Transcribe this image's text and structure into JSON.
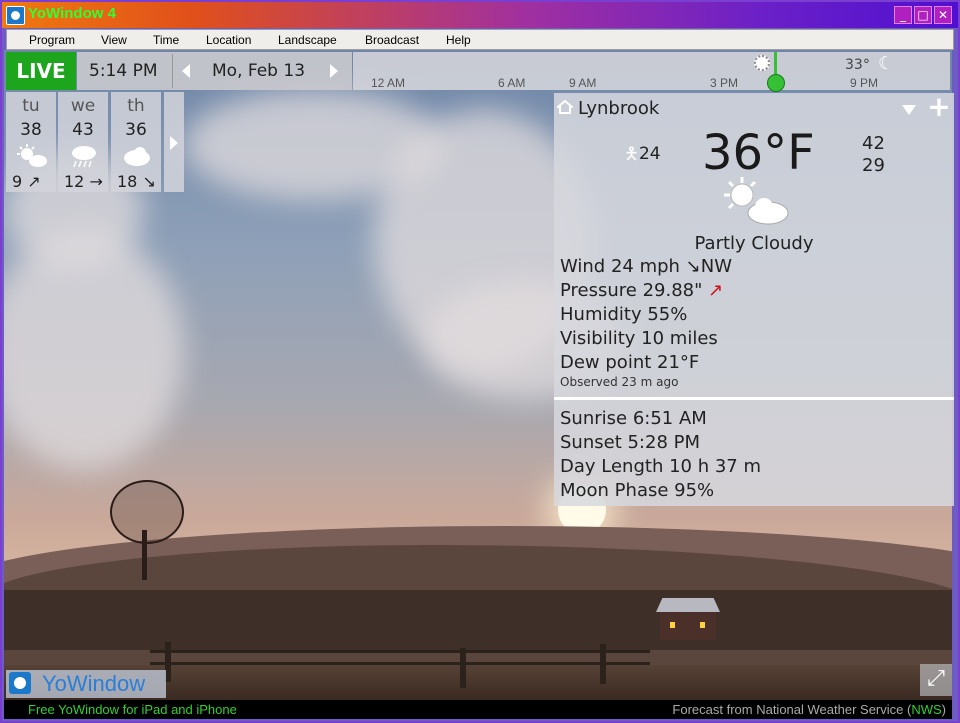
{
  "window": {
    "title": "YoWindow 4",
    "minimize": "_",
    "maximize": "□",
    "close": "✕"
  },
  "menu": [
    "Program",
    "View",
    "Time",
    "Location",
    "Landscape",
    "Broadcast",
    "Help"
  ],
  "topbar": {
    "live": "LIVE",
    "time": "5:14 PM",
    "date": "Mo, Feb 13",
    "ticks": [
      "12 AM",
      "6 AM",
      "9 AM",
      "3 PM",
      "9 PM"
    ],
    "timeline_temp": "33°"
  },
  "forecast": [
    {
      "day": "tu",
      "temp": "38",
      "icon": "partly-cloudy-icon",
      "wind": "9 ↗"
    },
    {
      "day": "we",
      "temp": "43",
      "icon": "rain-icon",
      "wind": "12 →"
    },
    {
      "day": "th",
      "temp": "36",
      "icon": "cloudy-icon",
      "wind": "18 ↘"
    }
  ],
  "current": {
    "location": "Lynbrook",
    "feels_like": "24",
    "temp": "36°F",
    "high": "42",
    "low": "29",
    "condition": "Partly Cloudy",
    "wind": "Wind  24 mph ↘NW",
    "pressure": "Pressure  29.88\"",
    "pressure_trend": "↗",
    "humidity": "Humidity  55%",
    "visibility": "Visibility  10 miles",
    "dew_point": "Dew point  21°F",
    "observed": "Observed 23 m ago"
  },
  "astro": {
    "sunrise": "Sunrise  6:51 AM",
    "sunset": "Sunset  5:28 PM",
    "day_length": "Day Length  10 h 37 m",
    "moon_phase": "Moon Phase  95%"
  },
  "logo": "YoWindow",
  "status": {
    "left": "Free YoWindow for iPad and iPhone",
    "right_prefix": "Forecast from National Weather Service (",
    "right_link": "NWS",
    "right_suffix": ")"
  },
  "colors": {
    "live": "#1ea51e",
    "brand": "#2a7fd8",
    "status_text": "#30d030"
  }
}
